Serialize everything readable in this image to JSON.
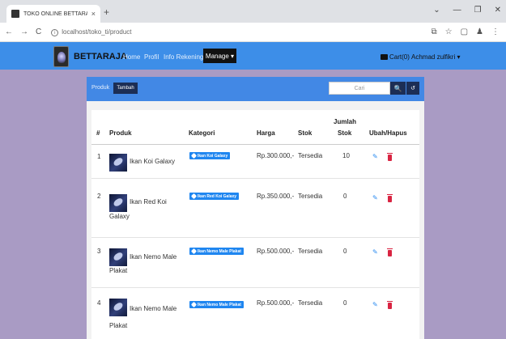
{
  "browser": {
    "tab_title": "TOKO ONLINE BETTARAJA",
    "tab_close": "×",
    "new_tab": "+",
    "url": "localhost/toko_ti/product",
    "window_controls": [
      "⌄",
      "—",
      "❐",
      "✕"
    ],
    "addr_icons": [
      "⧉",
      "☆",
      "▢",
      "♟",
      "⋮"
    ]
  },
  "navbar": {
    "brand": "BETTARAJA",
    "links": [
      "Home",
      "Profil",
      "Info Rekening"
    ],
    "manage_label": "Manage ▾",
    "cart_label": "Cart(0)",
    "user_label": "Achmad zulfikri ▾"
  },
  "panel": {
    "breadcrumb": "Produk",
    "add_button": "Tambah",
    "search_placeholder": "Cari",
    "search_icon": "🔍",
    "reset_icon": "↺"
  },
  "table": {
    "headers": {
      "no": "#",
      "product": "Produk",
      "category": "Kategori",
      "price": "Harga",
      "stock": "Stok",
      "stock_count_1": "Jumlah",
      "stock_count_2": "Stok",
      "actions": "Ubah/Hapus"
    },
    "rows": [
      {
        "no": "1",
        "name": "Ikan Koi Galaxy",
        "category": "Ikan Koi Galaxy",
        "price": "Rp.300.000,-",
        "stock": "Tersedia",
        "qty": "10"
      },
      {
        "no": "2",
        "name": "Ikan Red Koi",
        "name2": "Galaxy",
        "category": "Ikan Red Koi Galaxy",
        "price": "Rp.350.000,-",
        "stock": "Tersedia",
        "qty": "0"
      },
      {
        "no": "3",
        "name": "Ikan Nemo Male",
        "name2": "Plakat",
        "category": "Ikan Nemo Male Plakat",
        "price": "Rp.500.000,-",
        "stock": "Tersedia",
        "qty": "0"
      },
      {
        "no": "4",
        "name": "Ikan Nemo Male",
        "name2": "Plakat",
        "category": "Ikan Nemo Male Plakat",
        "price": "Rp.500.000,-",
        "stock": "Tersedia",
        "qty": "0"
      }
    ]
  }
}
